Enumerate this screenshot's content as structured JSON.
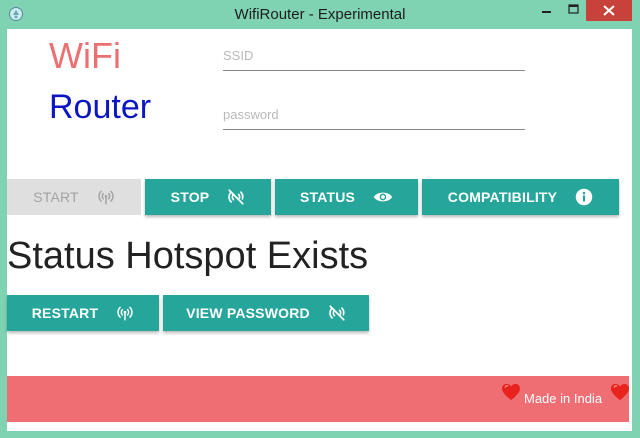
{
  "window": {
    "title": "WifiRouter - Experimental",
    "title_bar_color": "#7fd3b2",
    "close_color": "#c7423a"
  },
  "logo": {
    "line1": "WiFi",
    "line2": "Router",
    "line1_color": "#ec6f72",
    "line2_color": "#0b17c2"
  },
  "form": {
    "ssid": {
      "value": "",
      "placeholder": "SSID"
    },
    "password": {
      "value": "",
      "placeholder": "password"
    }
  },
  "buttons": {
    "start": {
      "label": "START",
      "icon": "wifi-tethering-icon",
      "state": "disabled"
    },
    "stop": {
      "label": "STOP",
      "icon": "portable-wifi-off-icon"
    },
    "status": {
      "label": "STATUS",
      "icon": "eye-icon"
    },
    "compatibility": {
      "label": "COMPATIBILITY",
      "icon": "info-icon"
    },
    "restart": {
      "label": "RESTART",
      "icon": "wifi-tethering-icon"
    },
    "view_password": {
      "label": "VIEW PASSWORD",
      "icon": "portable-wifi-off-icon"
    }
  },
  "status": {
    "text": "Status Hotspot Exists"
  },
  "footer": {
    "text": "Made in India",
    "icon": "heart-icon",
    "color": "#ee6e73"
  },
  "colors": {
    "accent": "#26a69a",
    "disabled": "#dfdfdf"
  }
}
